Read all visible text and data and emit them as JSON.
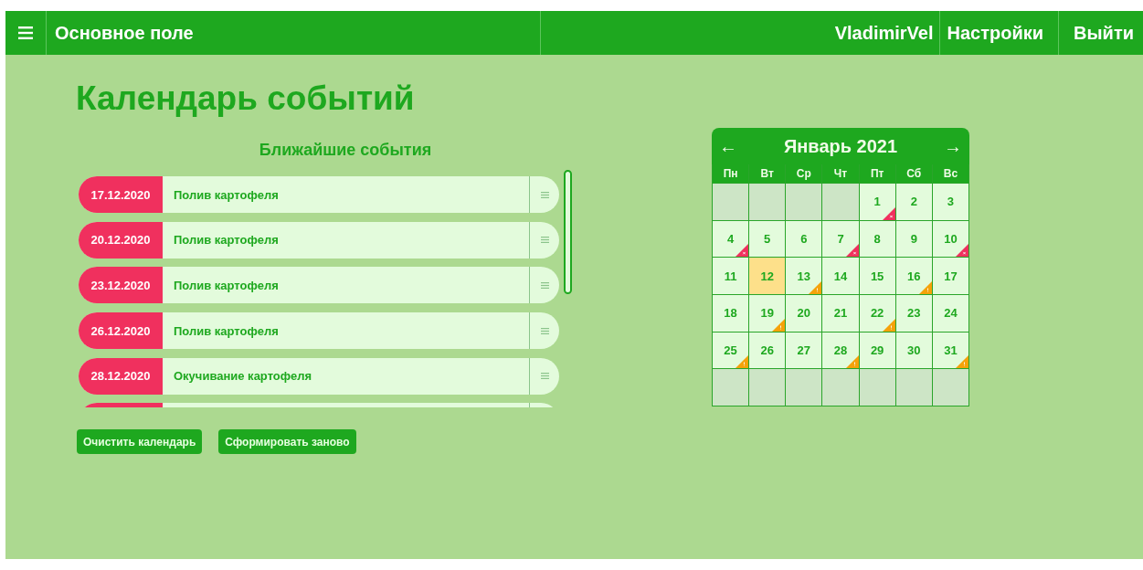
{
  "header": {
    "title": "Основное поле",
    "user": "VladimirVel",
    "links": [
      "Настройки",
      "Выйти"
    ]
  },
  "page_title": "Календарь событий",
  "events": {
    "title": "Ближайшие события",
    "items": [
      {
        "kind": "event",
        "date": "17.12.2020",
        "title": "Полив картофеля"
      },
      {
        "kind": "event",
        "date": "20.12.2020",
        "title": "Полив картофеля"
      },
      {
        "kind": "event",
        "date": "23.12.2020",
        "title": "Полив картофеля"
      },
      {
        "kind": "event",
        "date": "26.12.2020",
        "title": "Полив картофеля"
      },
      {
        "kind": "event",
        "date": "28.12.2020",
        "title": "Окучивание картофеля"
      },
      {
        "kind": "cut"
      }
    ]
  },
  "buttons": [
    "Очистить календарь",
    "Сформировать заново"
  ],
  "calendar": {
    "prev": "←",
    "month": "Январь 2021",
    "next": "→",
    "weekdays": [
      "Пн",
      "Вт",
      "Ср",
      "Чт",
      "Пт",
      "Сб",
      "Вс"
    ],
    "weeks": [
      [
        {
          "kind": "empty"
        },
        {
          "kind": "empty"
        },
        {
          "kind": "empty"
        },
        {
          "kind": "empty"
        },
        {
          "kind": "day",
          "day": "1",
          "selected": false,
          "alert": true,
          "warning": false
        },
        {
          "kind": "day",
          "day": "2",
          "selected": false,
          "alert": false,
          "warning": false
        },
        {
          "kind": "day",
          "day": "3",
          "selected": false,
          "alert": false,
          "warning": false
        }
      ],
      [
        {
          "kind": "day",
          "day": "4",
          "selected": false,
          "alert": true,
          "warning": false
        },
        {
          "kind": "day",
          "day": "5",
          "selected": false,
          "alert": false,
          "warning": false
        },
        {
          "kind": "day",
          "day": "6",
          "selected": false,
          "alert": false,
          "warning": false
        },
        {
          "kind": "day",
          "day": "7",
          "selected": false,
          "alert": true,
          "warning": false
        },
        {
          "kind": "day",
          "day": "8",
          "selected": false,
          "alert": false,
          "warning": false
        },
        {
          "kind": "day",
          "day": "9",
          "selected": false,
          "alert": false,
          "warning": false
        },
        {
          "kind": "day",
          "day": "10",
          "selected": false,
          "alert": true,
          "warning": false
        }
      ],
      [
        {
          "kind": "day",
          "day": "11",
          "selected": false,
          "alert": false,
          "warning": false
        },
        {
          "kind": "day",
          "day": "12",
          "selected": true,
          "alert": false,
          "warning": false
        },
        {
          "kind": "day",
          "day": "13",
          "selected": false,
          "alert": false,
          "warning": true
        },
        {
          "kind": "day",
          "day": "14",
          "selected": false,
          "alert": false,
          "warning": false
        },
        {
          "kind": "day",
          "day": "15",
          "selected": false,
          "alert": false,
          "warning": false
        },
        {
          "kind": "day",
          "day": "16",
          "selected": false,
          "alert": false,
          "warning": true
        },
        {
          "kind": "day",
          "day": "17",
          "selected": false,
          "alert": false,
          "warning": false
        }
      ],
      [
        {
          "kind": "day",
          "day": "18",
          "selected": false,
          "alert": false,
          "warning": false
        },
        {
          "kind": "day",
          "day": "19",
          "selected": false,
          "alert": false,
          "warning": true
        },
        {
          "kind": "day",
          "day": "20",
          "selected": false,
          "alert": false,
          "warning": false
        },
        {
          "kind": "day",
          "day": "21",
          "selected": false,
          "alert": false,
          "warning": false
        },
        {
          "kind": "day",
          "day": "22",
          "selected": false,
          "alert": false,
          "warning": true
        },
        {
          "kind": "day",
          "day": "23",
          "selected": false,
          "alert": false,
          "warning": false
        },
        {
          "kind": "day",
          "day": "24",
          "selected": false,
          "alert": false,
          "warning": false
        }
      ],
      [
        {
          "kind": "day",
          "day": "25",
          "selected": false,
          "alert": false,
          "warning": true
        },
        {
          "kind": "day",
          "day": "26",
          "selected": false,
          "alert": false,
          "warning": false
        },
        {
          "kind": "day",
          "day": "27",
          "selected": false,
          "alert": false,
          "warning": false
        },
        {
          "kind": "day",
          "day": "28",
          "selected": false,
          "alert": false,
          "warning": true
        },
        {
          "kind": "day",
          "day": "29",
          "selected": false,
          "alert": false,
          "warning": false
        },
        {
          "kind": "day",
          "day": "30",
          "selected": false,
          "alert": false,
          "warning": false
        },
        {
          "kind": "day",
          "day": "31",
          "selected": false,
          "alert": false,
          "warning": true
        }
      ],
      [
        {
          "kind": "empty"
        },
        {
          "kind": "empty"
        },
        {
          "kind": "empty"
        },
        {
          "kind": "empty"
        },
        {
          "kind": "empty"
        },
        {
          "kind": "empty"
        },
        {
          "kind": "empty"
        }
      ]
    ]
  }
}
